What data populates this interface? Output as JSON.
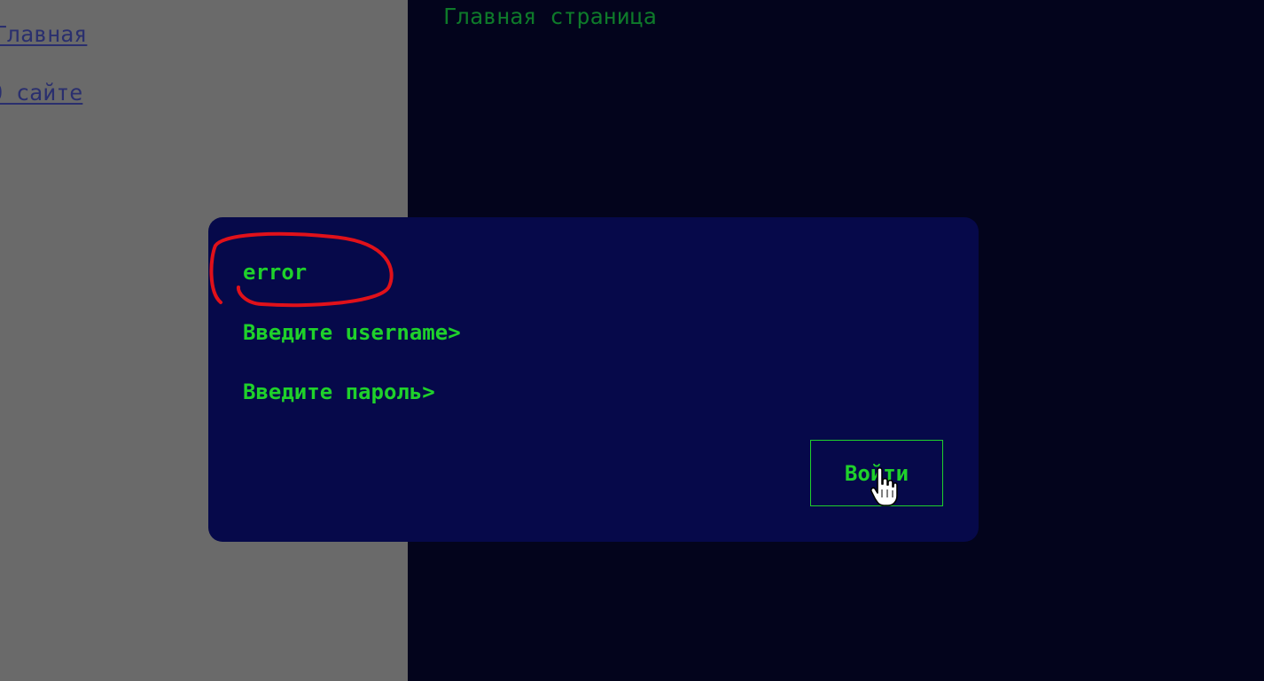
{
  "sidebar": {
    "links": [
      {
        "label": "Главная"
      },
      {
        "label": "О сайте"
      }
    ]
  },
  "main": {
    "title": "Главная страница"
  },
  "login_dialog": {
    "error_text": "error",
    "username_prompt": "Введите username>",
    "password_prompt": "Введите пароль>",
    "submit_label": "Войти"
  },
  "colors": {
    "page_background": "#03041c",
    "sidebar_background": "#6a6a6a",
    "sidebar_link": "#2a2f6e",
    "modal_background": "#06094a",
    "terminal_green": "#1fd12b",
    "title_green": "#0e7a2a",
    "annotation_red": "#e0111a"
  },
  "icons": {
    "cursor": "hand-pointer-icon"
  }
}
